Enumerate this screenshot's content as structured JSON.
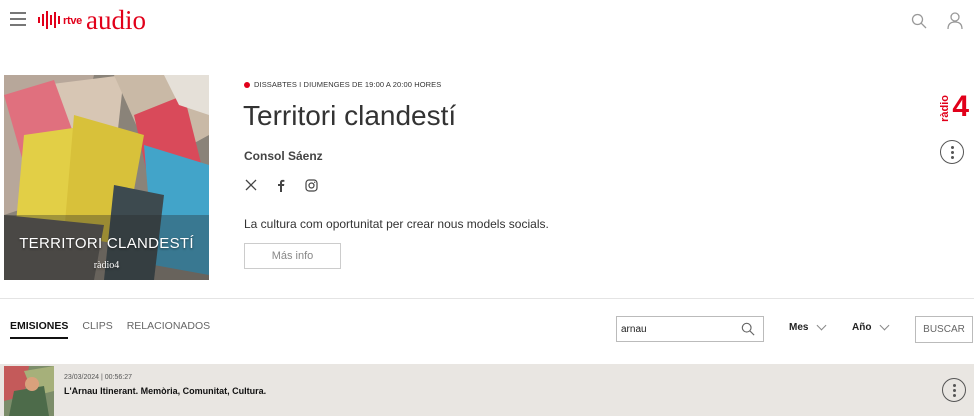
{
  "header": {
    "logo_rtve": "rtve",
    "logo_audio": "audio",
    "brand_color": "#e1001a",
    "menu_icon": "hamburger-menu-icon",
    "search_icon": "search-icon",
    "user_icon": "user-icon"
  },
  "program": {
    "cover_title": "TERRITORI CLANDESTÍ",
    "cover_subtitle": "ràdio4",
    "schedule": "DISSABTES I DIUMENGES DE 19:00 A 20:00 HORES",
    "title": "Territori clandestí",
    "host": "Consol Sáenz",
    "socials": [
      "x-icon",
      "facebook-icon",
      "instagram-icon"
    ],
    "description": "La cultura com oportunitat per crear nous models socials.",
    "more_info_label": "Más info",
    "station_word": "ràdio",
    "station_number": "4"
  },
  "tabs": {
    "emisiones": "EMISIONES",
    "clips": "CLIPS",
    "relacionados": "RELACIONADOS",
    "active": "EMISIONES"
  },
  "filters": {
    "search_value": "arnau",
    "month_label": "Mes",
    "year_label": "Año",
    "search_button": "BUSCAR"
  },
  "episodes": [
    {
      "meta": "23/03/2024 | 00:56:27",
      "title": "L'Arnau Itinerant. Memòria, Comunitat, Cultura."
    }
  ]
}
